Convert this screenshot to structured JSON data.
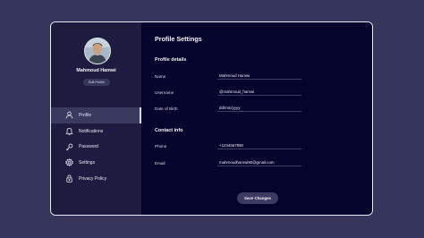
{
  "profile": {
    "name": "Mahmoud Hamwi",
    "edit_label": "Edit Profile"
  },
  "nav": {
    "items": [
      {
        "label": "Profile",
        "icon": "user-icon",
        "active": true
      },
      {
        "label": "Notifications",
        "icon": "bell-icon",
        "active": false
      },
      {
        "label": "Password",
        "icon": "key-icon",
        "active": false
      },
      {
        "label": "Settings",
        "icon": "gear-icon",
        "active": false
      },
      {
        "label": "Privacy Policy",
        "icon": "lock-icon",
        "active": false
      }
    ]
  },
  "main": {
    "title": "Profile Settings",
    "details_title": "Profile details",
    "contact_title": "Contact info",
    "fields": {
      "name": {
        "label": "Name",
        "value": "Mahmoud Hamwi"
      },
      "username": {
        "label": "Username",
        "value": "@mahmoud_hamwi"
      },
      "dob": {
        "label": "Date of Birth",
        "value": "dd/mm/yyyy"
      },
      "phone": {
        "label": "Phone",
        "value": "+1234567890"
      },
      "email": {
        "label": "Email",
        "value": "mahmoudhamwi90@gmail.com"
      }
    },
    "save_label": "Save Changes"
  },
  "colors": {
    "background": "#36355b",
    "sidebar": "#1d1c40",
    "main": "#05042d",
    "accent": "#3b3a63"
  }
}
